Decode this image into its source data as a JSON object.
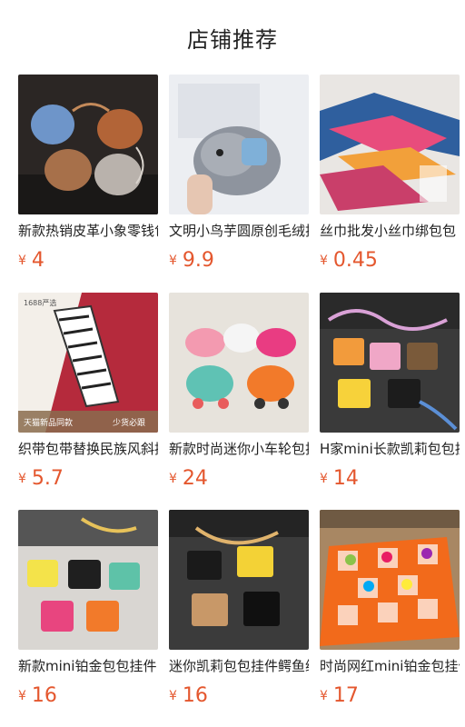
{
  "page": {
    "title": "店铺推荐"
  },
  "currency_symbol": "¥",
  "products": [
    {
      "title": "新款热销皮革小象零钱包",
      "price": "4"
    },
    {
      "title": "文明小鸟芋圆原创毛绒挂件",
      "price": "9.9"
    },
    {
      "title": "丝巾批发小丝巾绑包包",
      "price": "0.45"
    },
    {
      "title": "织带包带替换民族风斜挎",
      "price": "5.7",
      "badge_top": "1688严选",
      "badge_bottom_left": "天猫新品同款",
      "badge_bottom_right": "少货必跟"
    },
    {
      "title": "新款时尚迷你小车轮包挂件",
      "price": "24"
    },
    {
      "title": "H家mini长款凯莉包包挂件",
      "price": "14"
    },
    {
      "title": "新款mini铂金包包挂件",
      "price": "16"
    },
    {
      "title": "迷你凯莉包包挂件鳄鱼纹",
      "price": "16"
    },
    {
      "title": "时尚网红mini铂金包挂件",
      "price": "17"
    }
  ]
}
